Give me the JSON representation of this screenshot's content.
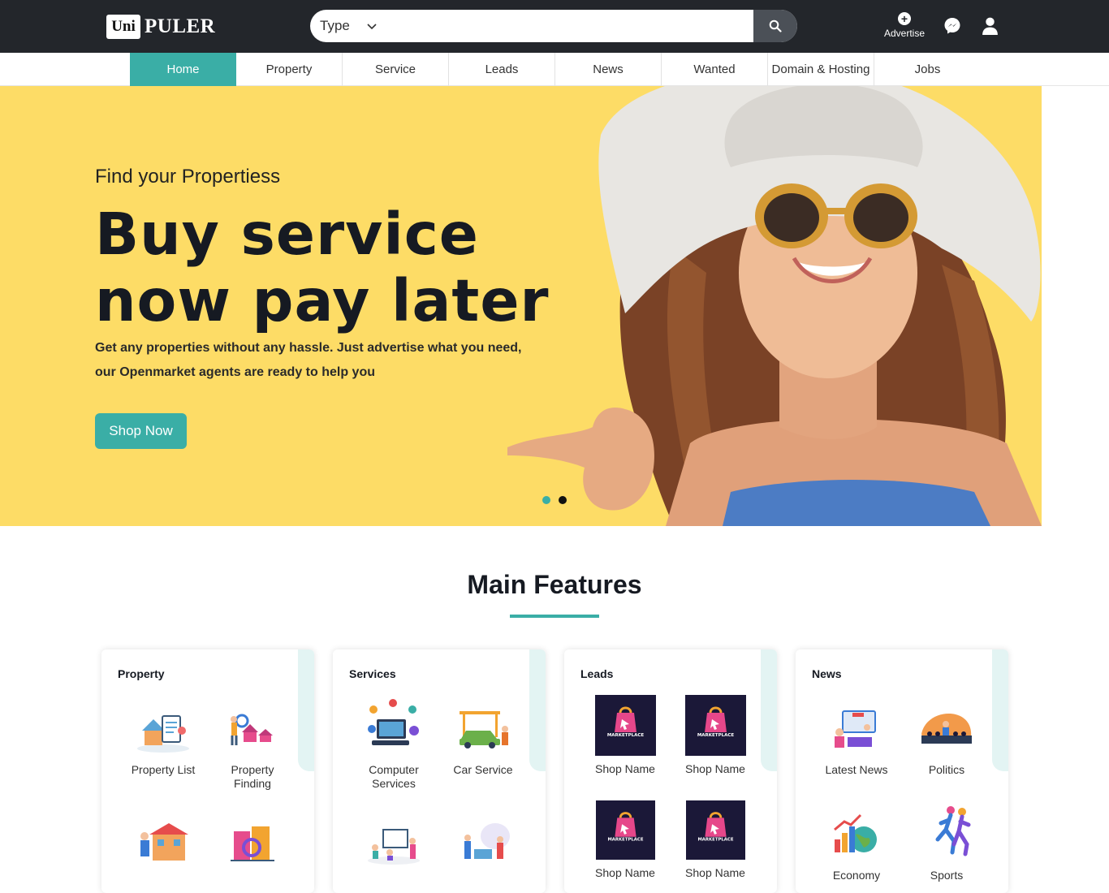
{
  "header": {
    "logo_box": "Uni",
    "logo_text": "PULER",
    "search": {
      "type_label": "Type",
      "placeholder": ""
    },
    "advertise_label": "Advertise",
    "icons": [
      "search-icon",
      "plus-icon",
      "messenger-icon",
      "user-icon"
    ]
  },
  "nav": {
    "items": [
      {
        "label": "Home",
        "active": true
      },
      {
        "label": "Property"
      },
      {
        "label": "Service"
      },
      {
        "label": "Leads"
      },
      {
        "label": "News"
      },
      {
        "label": "Wanted"
      },
      {
        "label": "Domain & Hosting"
      },
      {
        "label": "Jobs"
      }
    ]
  },
  "hero": {
    "kicker": "Find your Propertiess",
    "title_line1": "Buy service",
    "title_line2": "now pay later",
    "sub_line1": "Get any properties without any hassle. Just advertise what you need,",
    "sub_line2": "our Openmarket agents are ready to help you",
    "cta": "Shop Now",
    "slides": 2,
    "active_slide": 1
  },
  "features": {
    "title": "Main Features",
    "cards": [
      {
        "title": "Property",
        "items": [
          {
            "label_line1": "Property List",
            "label_line2": ""
          },
          {
            "label_line1": "Property",
            "label_line2": "Finding"
          }
        ]
      },
      {
        "title": "Services",
        "items": [
          {
            "label_line1": "Computer",
            "label_line2": "Services"
          },
          {
            "label_line1": "Car Service",
            "label_line2": ""
          }
        ]
      },
      {
        "title": "Leads",
        "items": [
          {
            "label": "Shop Name",
            "thumb_text": "MARKETPLACE"
          },
          {
            "label": "Shop Name",
            "thumb_text": "MARKETPLACE"
          },
          {
            "label": "Shop Name",
            "thumb_text": "MARKETPLACE"
          },
          {
            "label": "Shop Name",
            "thumb_text": "MARKETPLACE"
          }
        ]
      },
      {
        "title": "News",
        "items": [
          {
            "label": "Latest News"
          },
          {
            "label": "Politics"
          },
          {
            "label": "Economy"
          },
          {
            "label": "Sports"
          }
        ]
      }
    ]
  },
  "colors": {
    "accent": "#3aaea6",
    "topbar": "#23262b",
    "hero_bg": "#fddc66"
  }
}
